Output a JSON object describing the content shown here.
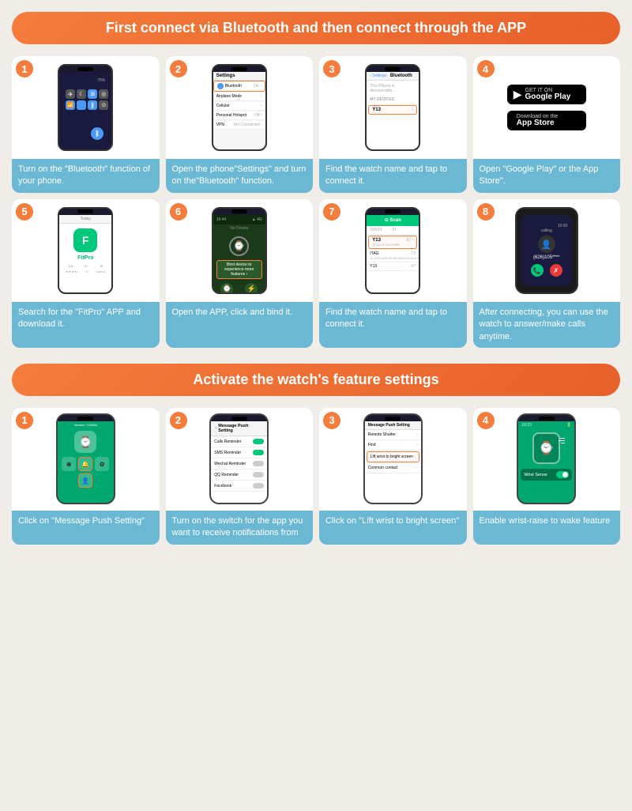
{
  "page": {
    "background": "#f0ede8"
  },
  "section1": {
    "header": "First connect via Bluetooth and then connect through the APP",
    "steps": [
      {
        "number": "1",
        "description": "Turn on the \"Bluetooth\" function of your phone."
      },
      {
        "number": "2",
        "description": "Open the phone\"Settings\" and turn on the\"Bluetooth\" function."
      },
      {
        "number": "3",
        "description": "Find the watch name and tap to connect it."
      },
      {
        "number": "4",
        "description": "Open \"Google Play\" or the App Store\"."
      },
      {
        "number": "5",
        "description": "Search for the \"FitPro\" APP and download it."
      },
      {
        "number": "6",
        "description": "Open the APP, click and bind it."
      },
      {
        "number": "7",
        "description": "Find the watch name and tap to connect it."
      },
      {
        "number": "8",
        "description": "After connecting, you can use the watch to answer/make calls anytime."
      }
    ],
    "google_play_label_small": "GET IT ON",
    "google_play_label_big": "Google Play",
    "app_store_label_small": "Download on the",
    "app_store_label_big": "App Store",
    "fitpro_label": "FitPro",
    "watch_name": "Y13",
    "calling_number": "(626)105****",
    "watch_time": "10:00",
    "calling_text": "calling"
  },
  "section2": {
    "header": "Activate the watch's feature settings",
    "steps": [
      {
        "number": "1",
        "description": "Click on \"Message Push Setting\""
      },
      {
        "number": "2",
        "description": "Turn on the switch for the app you want to receive notifications from"
      },
      {
        "number": "3",
        "description": "Click on \"Lift wrist to bright screen\""
      },
      {
        "number": "4",
        "description": "Enable wrist-raise to wake feature"
      }
    ],
    "msg_push_title": "Message Push Setting",
    "msg_items": [
      {
        "label": "Calls Reminder",
        "on": true
      },
      {
        "label": "SMS Reminder",
        "on": true
      },
      {
        "label": "Wechat Reminder",
        "on": false
      },
      {
        "label": "QQ Reminder",
        "on": false
      },
      {
        "label": "Facebook",
        "on": false
      }
    ],
    "lift_wrist_text": "Lift wrist to bright screen",
    "wrist_sense_label": "Wrist Sense",
    "version_label": "Version: V13653",
    "msg_push_setting_label": "Message Push Setting",
    "remote_shutter_label": "Remote Shutter",
    "find_label": "Find",
    "common_contact_label": "Common contact"
  }
}
